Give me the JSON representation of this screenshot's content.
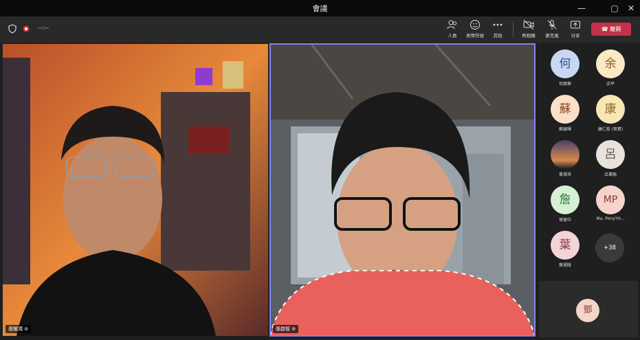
{
  "window": {
    "title": "會議"
  },
  "toolbar": {
    "timer": "--:--",
    "people_label": "人員",
    "reactions_label": "表情符號",
    "more_label": "其他",
    "camera_label": "照相機",
    "mic_label": "麥克風",
    "share_label": "分享",
    "leave_label": "離開",
    "leave_color": "#c4314b"
  },
  "videos": {
    "left_name": "張耀鴻",
    "right_name": "張啟智"
  },
  "participants": [
    {
      "initial": "何",
      "name": "何燦華",
      "color": "#c8d8f2"
    },
    {
      "initial": "余",
      "name": "余平",
      "color": "#fbe8c6"
    },
    {
      "initial": "蘇",
      "name": "蘇展暉",
      "color": "#fbe0c9"
    },
    {
      "initial": "康",
      "name": "康仁俊 (來賓)",
      "color": "#f8e6b7"
    },
    {
      "initial": "",
      "name": "黃湘淇",
      "color": "#6a5a7e"
    },
    {
      "initial": "呂",
      "name": "呂秉融",
      "color": "#e8e2dc"
    },
    {
      "initial": "詹",
      "name": "保留中",
      "color": "#d7f0d4"
    },
    {
      "initial": "MP",
      "name": "Ma. PonyYH...",
      "color": "#f6d3cb"
    },
    {
      "initial": "葉",
      "name": "葉湘陵",
      "color": "#f3d5d8"
    }
  ],
  "more_count": "+38",
  "bottom_avatar": "鄧"
}
